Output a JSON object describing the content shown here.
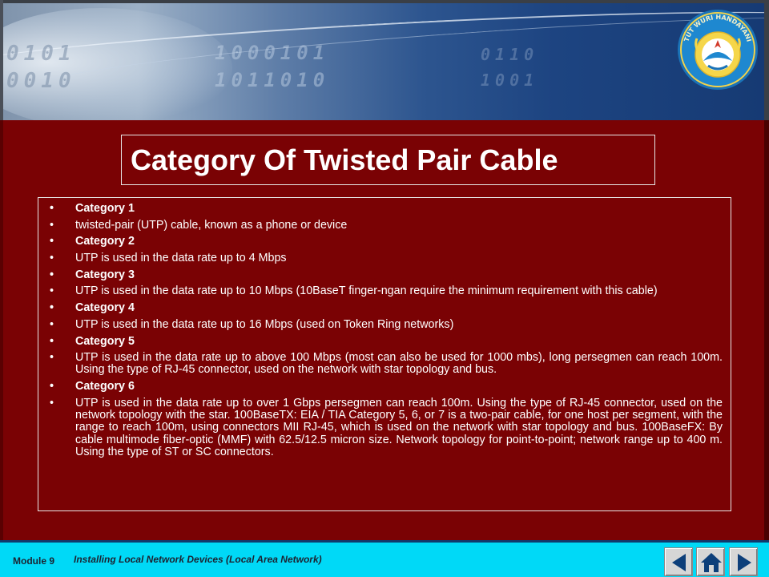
{
  "header": {
    "binary_text": [
      "0101",
      "0010",
      "1000101",
      "1011010",
      "0110",
      "1001"
    ],
    "logo_text": "TUT WURI HANDAYANI"
  },
  "slide": {
    "title": "Category Of Twisted Pair Cable",
    "items": [
      {
        "type": "heading",
        "text": "Category 1"
      },
      {
        "type": "text",
        "text": "twisted-pair (UTP) cable, known as a phone or device"
      },
      {
        "type": "heading",
        "text": "Category 2"
      },
      {
        "type": "text",
        "text": "UTP is used in the data rate up to 4 Mbps"
      },
      {
        "type": "heading",
        "text": "Category 3"
      },
      {
        "type": "text",
        "text": "UTP is used in the data rate up to 10 Mbps (10BaseT finger-ngan require the minimum requirement with this cable)"
      },
      {
        "type": "heading",
        "text": "Category 4"
      },
      {
        "type": "text",
        "text": "UTP is used in the data rate up to 16 Mbps (used on Token Ring networks)"
      },
      {
        "type": "heading",
        "text": "Category 5"
      },
      {
        "type": "text",
        "text": "UTP is used in the data rate up to above 100 Mbps (most can also be used for 1000 mbs), long persegmen can reach 100m. Using the type of RJ-45 connector, used on the network with star topology and bus."
      },
      {
        "type": "heading",
        "text": "Category 6"
      },
      {
        "type": "text",
        "text": "UTP is used in the data rate up to over 1 Gbps persegmen can reach 100m. Using the type of RJ-45 connector, used on the network topology with the star. 100BaseTX: EIA / TIA Category 5, 6, or 7 is a two-pair cable, for one host per segment, with the range to reach 100m, using connectors MII RJ-45, which is used on the network with star topology and bus. 100BaseFX: By cable multimode fiber-optic (MMF) with 62.5/12.5 micron size. Network topology for point-to-point; network range up to 400 m. Using the type of ST or SC connectors."
      }
    ],
    "bullet": "•"
  },
  "footer": {
    "module_label": "Module  9",
    "description": "Installing Local Network Devices (Local Area Network)",
    "nav": {
      "prev_icon": "triangle-left-icon",
      "home_icon": "home-icon",
      "next_icon": "triangle-right-icon"
    }
  },
  "colors": {
    "main_background": "#7a0204",
    "footer_background": "#00d9f7",
    "banner_dark": "#163a73",
    "text": "#ffffff"
  }
}
